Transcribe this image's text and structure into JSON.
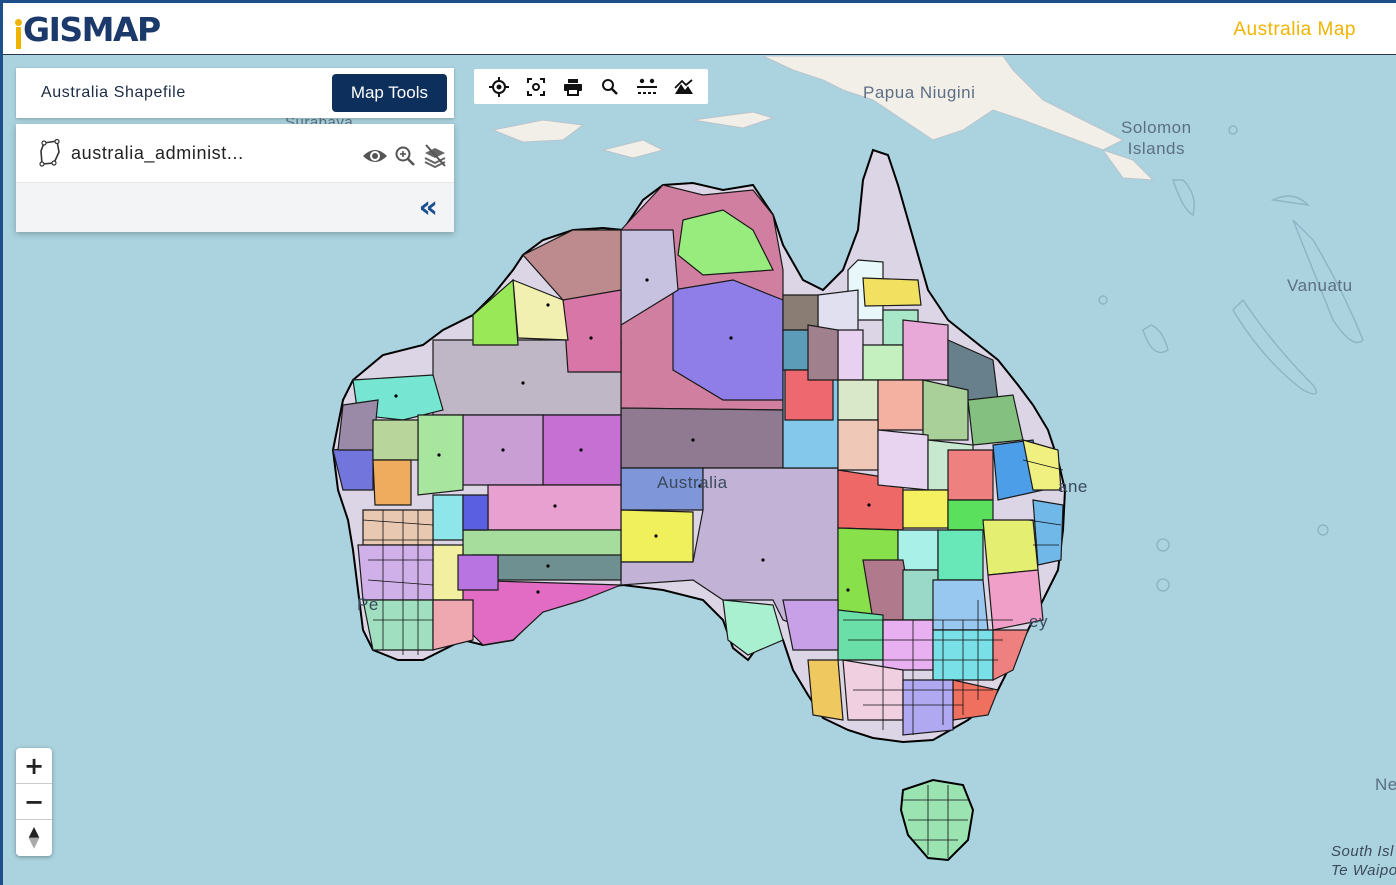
{
  "header": {
    "logo_text": "GISMAP",
    "title": "Australia Map"
  },
  "panel": {
    "title": "Australia Shapefile",
    "map_tools_label": "Map Tools",
    "layer_name": "australia_administ...",
    "collapse_symbol": "«"
  },
  "toolbar": {
    "tools": [
      "locate-icon",
      "fullscreen-icon",
      "print-icon",
      "search-icon",
      "measure-icon",
      "terrain-icon"
    ]
  },
  "zoom": {
    "zoom_in": "+",
    "zoom_out": "−",
    "north": "▲"
  },
  "map_labels": {
    "papua": "Papua Niugini",
    "solomon": "Solomon\nIslands",
    "vanuatu": "Vanuatu",
    "australia": "Australia",
    "surabaya": "Surabaya",
    "brisbane": "ane",
    "sydney": "ey",
    "perth": "Pe",
    "nz_north": "Ne",
    "south_island": "South Isl\nTe Waipou"
  },
  "colors": {
    "sea": "#aad3df",
    "land": "#f2efe9",
    "brand": "#1b3a6b",
    "accent": "#f0b400",
    "button": "#0d2f5c"
  }
}
